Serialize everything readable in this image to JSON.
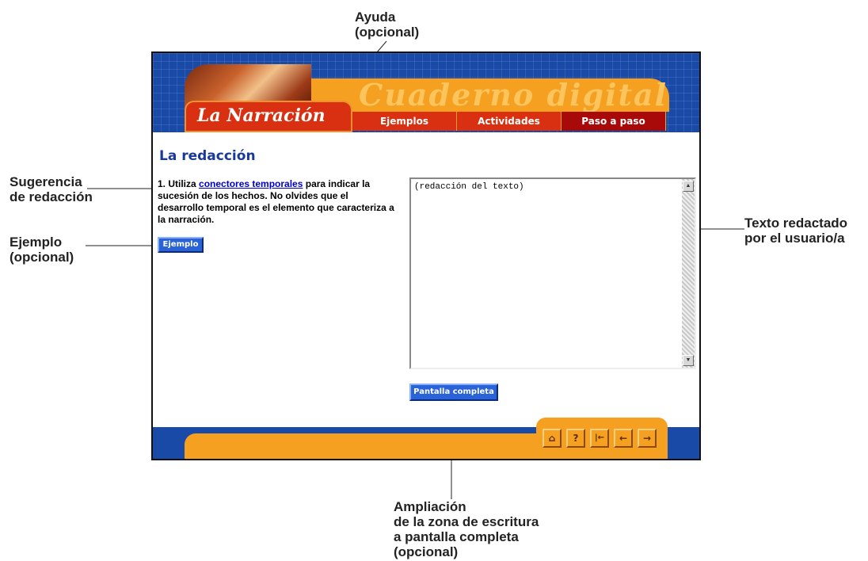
{
  "app": {
    "title": "Cuaderno digital",
    "section": "La Narración",
    "tabs": [
      {
        "label": "Ejemplos",
        "color": "#d83010"
      },
      {
        "label": "Actividades",
        "color": "#d83010"
      },
      {
        "label": "Paso a paso",
        "color": "#a80a0a"
      }
    ]
  },
  "main": {
    "heading": "La redacción",
    "suggestion_prefix": "1. Utiliza ",
    "suggestion_link": "conectores temporales",
    "suggestion_suffix": " para indicar la sucesión de los hechos. No olvides que el desarrollo temporal es el elemento que caracteriza a la narración.",
    "example_button": "Ejemplo",
    "textarea_value": "(redacción del texto)",
    "fullscreen_button": "Pantalla completa"
  },
  "nav_buttons": [
    {
      "icon": "home-icon",
      "glyph": "⌂"
    },
    {
      "icon": "help-icon",
      "glyph": "?"
    },
    {
      "icon": "first-page-icon",
      "glyph": "|←"
    },
    {
      "icon": "prev-icon",
      "glyph": "←"
    },
    {
      "icon": "next-icon",
      "glyph": "→"
    }
  ],
  "annotations": {
    "ayuda": "Ayuda (opcional)",
    "ayuda_line1": "Ayuda",
    "ayuda_line2": "(opcional)",
    "sugerencia_line1": "Sugerencia",
    "sugerencia_line2": "de redacción",
    "ejemplo_line1": "Ejemplo",
    "ejemplo_line2": "(opcional)",
    "texto_line1": "Texto redactado",
    "texto_line2": "por el usuario/a",
    "ampliacion_line1": "Ampliación",
    "ampliacion_line2": "de la zona de escritura",
    "ampliacion_line3": "a pantalla completa",
    "ampliacion_line4": "(opcional)"
  },
  "colors": {
    "frame_blue": "#1a4aa8",
    "orange": "#f5a020",
    "red": "#d83010",
    "link": "#0000cc"
  }
}
